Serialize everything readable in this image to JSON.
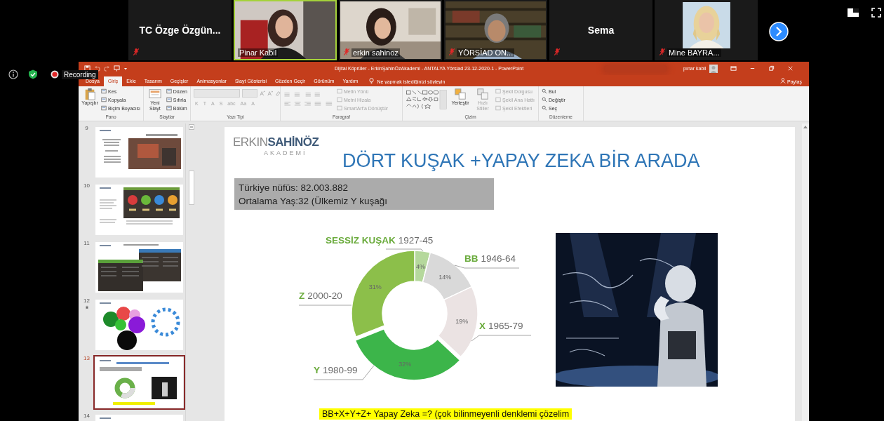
{
  "meeting": {
    "participants": [
      {
        "name": "TC Özge Özgün...",
        "kind": "name",
        "muted": true,
        "speaking": false
      },
      {
        "name": "Pinar Kabil",
        "kind": "video",
        "muted": false,
        "speaking": true
      },
      {
        "name": "erkin sahinoz",
        "kind": "video",
        "muted": true,
        "speaking": false
      },
      {
        "name": "YÖRSİAD ON...",
        "kind": "video",
        "muted": true,
        "speaking": false
      },
      {
        "name": "Sema",
        "kind": "name",
        "muted": true,
        "speaking": false
      },
      {
        "name": "Mine BAYRA...",
        "muted": true,
        "speaking": false
      }
    ],
    "recording": "Recording"
  },
  "powerpoint": {
    "title": "Dijital Köprüler - ErkinŞahinÖzAkademi - ANTALYA Yörsiad 23-12-2020-1  -  PowerPoint",
    "user": "pınar kabil",
    "tabs": [
      {
        "label": "Dosya",
        "selected": false
      },
      {
        "label": "Giriş",
        "selected": true
      },
      {
        "label": "Ekle",
        "selected": false
      },
      {
        "label": "Tasarım",
        "selected": false
      },
      {
        "label": "Geçişler",
        "selected": false
      },
      {
        "label": "Animasyonlar",
        "selected": false
      },
      {
        "label": "Slayt Gösterisi",
        "selected": false
      },
      {
        "label": "Gözden Geçir",
        "selected": false
      },
      {
        "label": "Görünüm",
        "selected": false
      },
      {
        "label": "Yardım",
        "selected": false
      }
    ],
    "tell_me": {
      "placeholder": "Ne yapmak istediğinizi söyleyin"
    },
    "share": "Paylaş",
    "ribbon": [
      {
        "label": "Pano",
        "kind": "clipboard",
        "items": [
          {
            "label": "Yapıştır",
            "disabled": false
          },
          {
            "label": "Kes",
            "disabled": false
          },
          {
            "label": "Kopyala",
            "disabled": false
          },
          {
            "label": "Biçim Boyacısı",
            "disabled": false
          }
        ]
      },
      {
        "label": "Slaytlar",
        "kind": "slides",
        "items": [
          {
            "label": "Yeni Slayt",
            "disabled": false
          },
          {
            "label": "Düzen",
            "disabled": false
          },
          {
            "label": "Sıfırla",
            "disabled": false
          },
          {
            "label": "Bölüm",
            "disabled": false
          }
        ]
      },
      {
        "label": "Yazı Tipi",
        "kind": "font",
        "items": [
          {
            "label": "K",
            "disabled": true
          },
          {
            "label": "T",
            "disabled": true
          },
          {
            "label": "A",
            "disabled": true
          },
          {
            "label": "S",
            "disabled": true
          },
          {
            "label": "abc",
            "disabled": true
          },
          {
            "label": "Aa",
            "disabled": true
          },
          {
            "label": "A",
            "disabled": true
          }
        ]
      },
      {
        "label": "Paragraf",
        "kind": "paragraph",
        "items": [
          {
            "label": "Metin Yönü",
            "disabled": true
          },
          {
            "label": "Metni Hizala",
            "disabled": true
          },
          {
            "label": "SmartArt'a Dönüştür",
            "disabled": true
          }
        ]
      },
      {
        "label": "Çizim",
        "kind": "drawing",
        "items": [
          {
            "label": "Yerleştir",
            "disabled": false
          },
          {
            "label": "Hızlı Stiller",
            "disabled": true
          },
          {
            "label": "Şekil Dolgusu",
            "disabled": true
          },
          {
            "label": "Şekil Ana Hattı",
            "disabled": true
          },
          {
            "label": "Şekil Efektleri",
            "disabled": true
          }
        ]
      },
      {
        "label": "Düzenleme",
        "kind": "editing",
        "items": [
          {
            "label": "Bul",
            "disabled": false
          },
          {
            "label": "Değiştir",
            "disabled": false
          },
          {
            "label": "Seç",
            "disabled": false
          }
        ]
      }
    ],
    "thumbnails": [
      {
        "number": "9",
        "selected": false,
        "animated": false
      },
      {
        "number": "10",
        "kind": "dashboard",
        "selected": false,
        "animated": false
      },
      {
        "number": "11",
        "kind": "tables",
        "selected": false,
        "animated": false
      },
      {
        "number": "12",
        "kind": "bubbles",
        "selected": false,
        "animated": true
      },
      {
        "number": "13",
        "kind": "donut",
        "selected": true,
        "animated": false
      },
      {
        "number": "14",
        "kind": "partial",
        "selected": false,
        "animated": false
      }
    ],
    "slide": {
      "logo": {
        "first": "ERKIN",
        "second": "SAHİNÖZ",
        "third": "AKADEMİ"
      },
      "title": "DÖRT KUŞAK +YAPAY ZEKA BİR ARADA",
      "info_lines": [
        "Türkiye nüfüs: 82.003.882",
        "Ortalama Yaş:32 (Ülkemiz Y kuşağı"
      ],
      "chart": {
        "years": [
          "1927-45",
          "1946-64",
          "1965-79",
          "1980-99",
          "2000-20"
        ],
        "chart_data": {
          "type": "donut",
          "categories": [
            "SESSİZ KUŞAK",
            "BB",
            "X",
            "Y",
            "Z"
          ],
          "values": [
            4,
            14,
            19,
            32,
            31
          ],
          "value_labels": [
            "4%",
            "14%",
            "19%",
            "32%",
            "31%"
          ]
        }
      },
      "picture": {
        "kind": "picture"
      },
      "note": "BB+X+Y+Z+ Yapay Zeka =?  (çok bilinmeyenli denklemi çözelim"
    }
  }
}
